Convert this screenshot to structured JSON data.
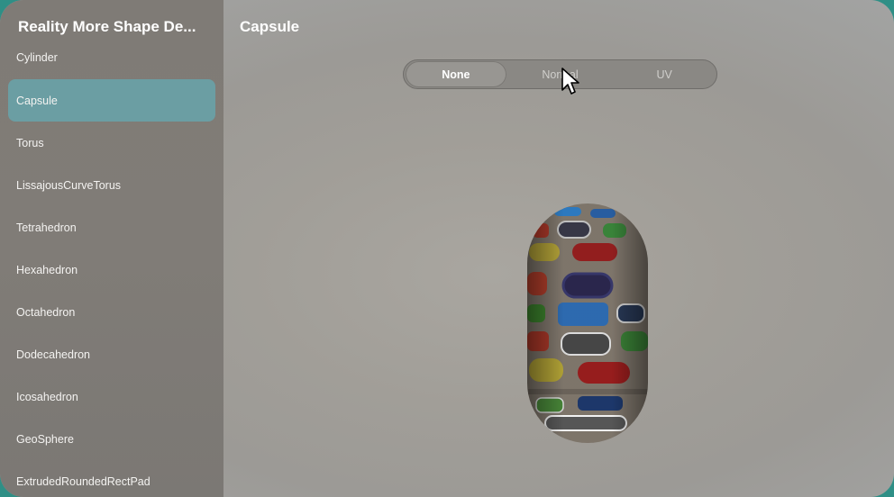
{
  "sidebar": {
    "title": "Reality More Shape De...",
    "items": [
      {
        "label": "Cylinder",
        "selected": false
      },
      {
        "label": "Capsule",
        "selected": true
      },
      {
        "label": "Torus",
        "selected": false
      },
      {
        "label": "LissajousCurveTorus",
        "selected": false
      },
      {
        "label": "Tetrahedron",
        "selected": false
      },
      {
        "label": "Hexahedron",
        "selected": false
      },
      {
        "label": "Octahedron",
        "selected": false
      },
      {
        "label": "Dodecahedron",
        "selected": false
      },
      {
        "label": "Icosahedron",
        "selected": false
      },
      {
        "label": "GeoSphere",
        "selected": false
      },
      {
        "label": "ExtrudedRoundedRectPad",
        "selected": false
      }
    ]
  },
  "main": {
    "title": "Capsule",
    "segments": [
      {
        "label": "None",
        "selected": true
      },
      {
        "label": "Normal",
        "selected": false
      },
      {
        "label": "UV",
        "selected": false
      }
    ]
  },
  "colors": {
    "selection": "#6b9ea3",
    "sidebar_bg": "#7f7b76"
  },
  "icons": [
    "mouse-pointer-icon"
  ]
}
